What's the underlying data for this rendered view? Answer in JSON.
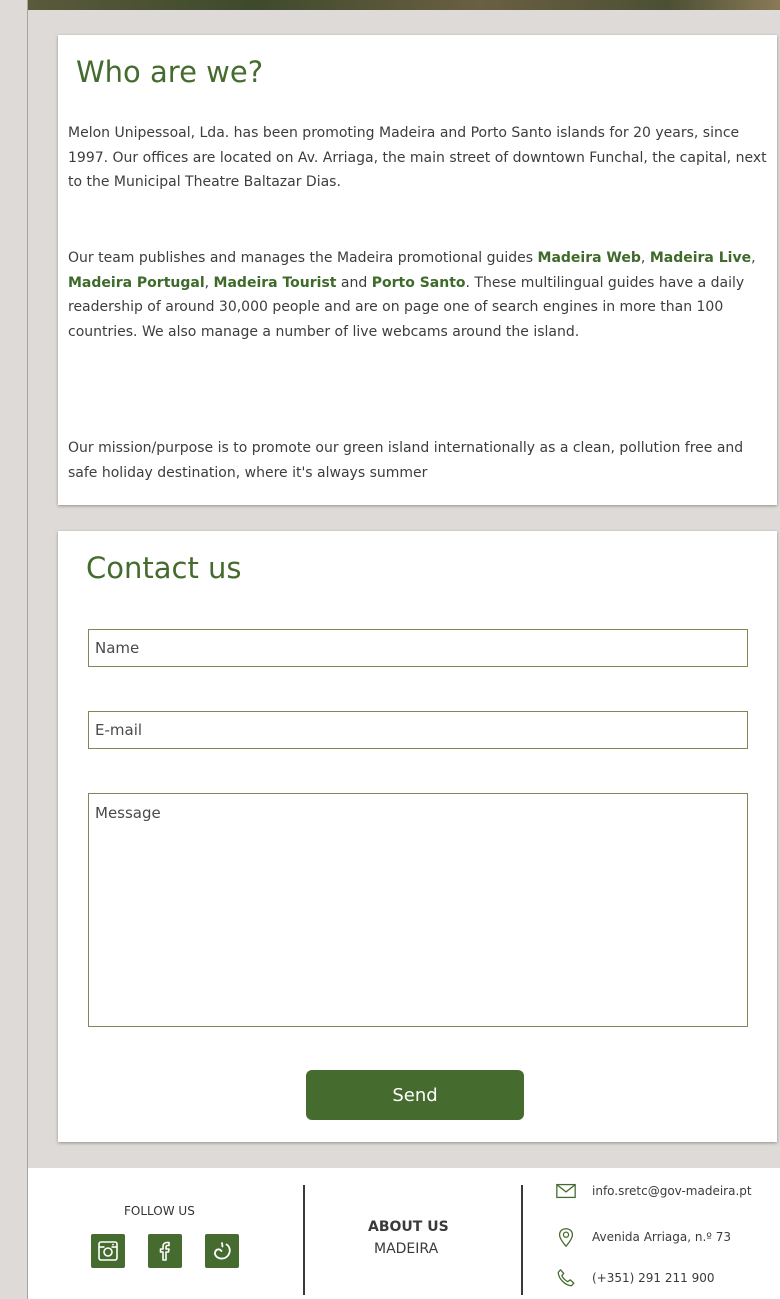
{
  "about": {
    "title": "Who are we?",
    "p1": "Melon Unipessoal, Lda. has been promoting Madeira and Porto Santo islands for 20 years, since 1997. Our offices are located on Av. Arriaga, the main street of downtown Funchal, the capital, next to the Municipal Theatre Baltazar Dias.",
    "p2": {
      "t1": "Our team publishes and manages the Madeira promotional guides ",
      "link1": "Madeira Web",
      "sep1": ", ",
      "link2": "Madeira Live",
      "sep2": ", ",
      "link3": "Madeira Portugal",
      "sep3": ", ",
      "link4": "Madeira Tourist",
      "sep4": " and ",
      "link5": "Porto Santo",
      "t2": ". These multilingual guides have a daily readership of around 30,000 people and are on page one of search engines in more than 100 countries. We also manage a number of live webcams around the island."
    },
    "p3": "Our mission/purpose is to promote our green island internationally as a clean, pollution free and safe holiday destination, where it's always summer"
  },
  "contact": {
    "title": "Contact us",
    "name_placeholder": "Name",
    "email_placeholder": "E-mail",
    "message_placeholder": "Message",
    "send_label": "Send"
  },
  "footer": {
    "follow_label": "FOLLOW US",
    "social_icons": [
      "instagram-icon",
      "facebook-icon",
      "tripadvisor-icon"
    ],
    "about_title": "ABOUT US",
    "about_sub": "MADEIRA",
    "email": "info.sretc@gov-madeira.pt",
    "address": "Avenida Arriaga, n.º 73",
    "phone": "(+351) 291 211 900"
  },
  "colors": {
    "accent": "#456b2e",
    "background": "#dedad7"
  }
}
